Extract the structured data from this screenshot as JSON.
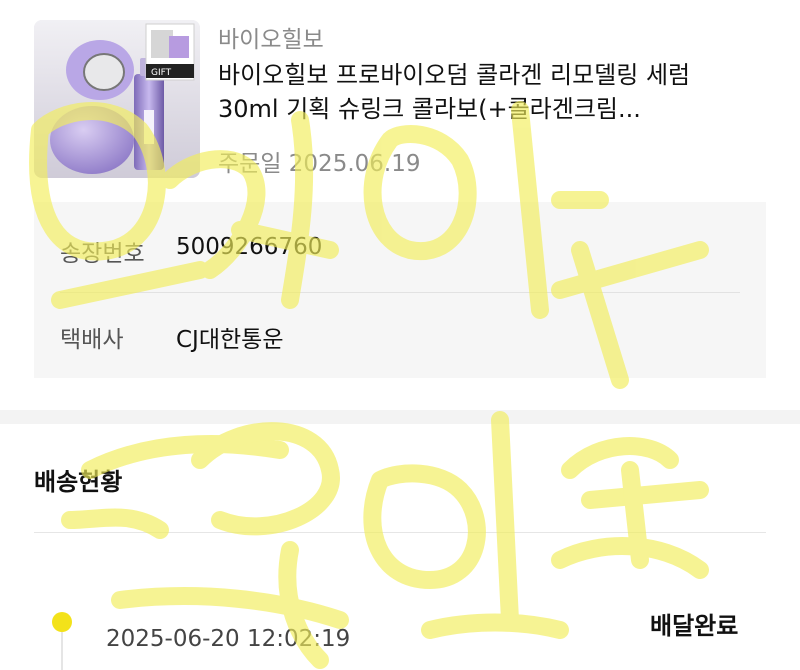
{
  "product": {
    "brand": "바이오힐보",
    "name_line1": "바이오힐보 프로바이오덤 콜라겐 리모델링 세럼",
    "name_line2": "30ml 기획 슈링크 콜라보(+콜라겐크림...",
    "order_date": "주문일 2025.06.19",
    "thumb_gift_label": "GIFT"
  },
  "shipping_info": {
    "tracking_label": "송장번호",
    "tracking_value": "5009266760",
    "carrier_label": "택배사",
    "carrier_value": "CJ대한통운"
  },
  "delivery_status": {
    "title": "배송현황",
    "events": [
      {
        "time": "2025-06-20 12:02:19",
        "status": "배달완료"
      }
    ]
  },
  "colors": {
    "accent_dot": "#f3e21a",
    "highlighter": "#f2ee5a"
  }
}
